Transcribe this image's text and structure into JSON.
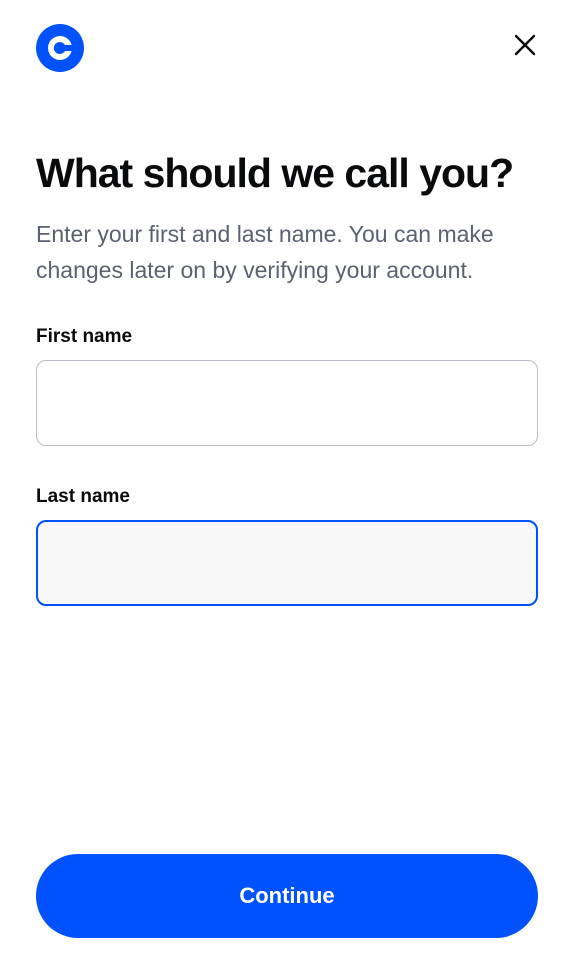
{
  "colors": {
    "brand": "#0052ff",
    "text_primary": "#0a0b0d",
    "text_secondary": "#5b616e",
    "input_border": "#b8bcc4"
  },
  "header": {
    "logo_icon": "coinbase-logo-icon",
    "close_icon": "close-icon"
  },
  "main": {
    "title": "What should we call you?",
    "subtitle": "Enter your first and last name. You can make changes later on by verifying your account.",
    "first_name": {
      "label": "First name",
      "value": "",
      "placeholder": ""
    },
    "last_name": {
      "label": "Last name",
      "value": "",
      "placeholder": ""
    }
  },
  "footer": {
    "continue_label": "Continue"
  }
}
